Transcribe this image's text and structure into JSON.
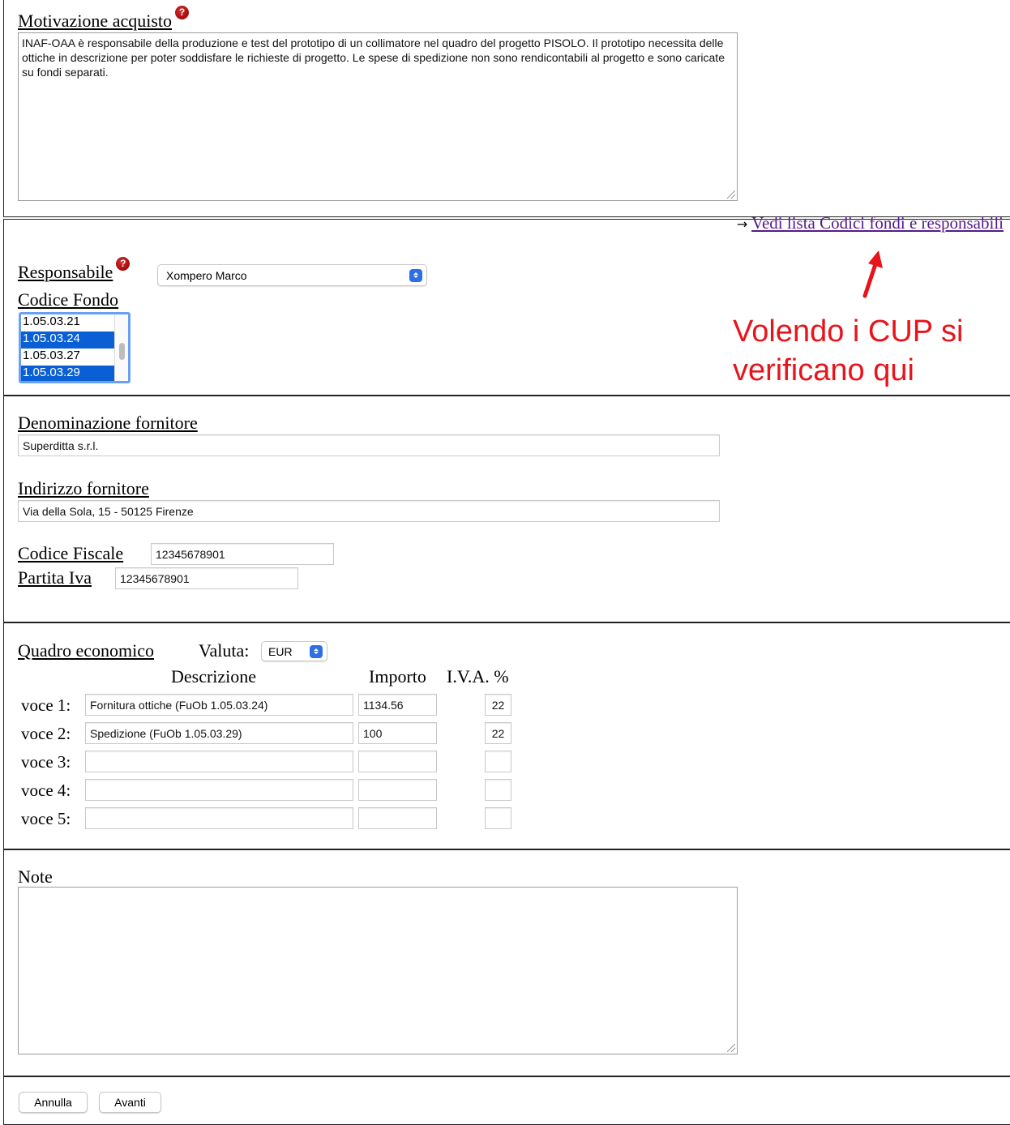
{
  "motivazione": {
    "label": "Motivazione acquisto",
    "help_icon": "?",
    "text": "INAF-OAA è responsabile della produzione e test del prototipo di un collimatore nel quadro del progetto PISOLO. Il prototipo necessita delle ottiche in descrizione per poter soddisfare le richieste di progetto. Le spese di spedizione non sono rendicontabili al progetto e sono caricate su fondi separati."
  },
  "fondi": {
    "arrow": "→",
    "link_label": "Vedi lista Codici fondi e responsabili",
    "responsabile_label": "Responsabile",
    "help_icon": "?",
    "responsabile_value": "Xompero Marco",
    "codice_fondo_label": "Codice Fondo",
    "codici": [
      {
        "code": "1.05.03.21",
        "selected": false
      },
      {
        "code": "1.05.03.24",
        "selected": true
      },
      {
        "code": "1.05.03.27",
        "selected": false
      },
      {
        "code": "1.05.03.29",
        "selected": true
      }
    ],
    "annotation_line1": "Volendo i CUP si",
    "annotation_line2": "verificano qui",
    "annotation_color": "#e8141b"
  },
  "fornitore": {
    "denominazione_label": "Denominazione fornitore",
    "denominazione_value": "Superditta s.r.l.",
    "indirizzo_label": "Indirizzo fornitore",
    "indirizzo_value": "Via della Sola, 15 - 50125 Firenze",
    "cf_label": "Codice Fiscale",
    "cf_value": "12345678901",
    "piva_label": "Partita Iva",
    "piva_value": "12345678901"
  },
  "quadro": {
    "label": "Quadro economico",
    "valuta_label": "Valuta:",
    "valuta_value": "EUR",
    "col_descrizione": "Descrizione",
    "col_importo": "Importo",
    "col_iva": "I.V.A. %",
    "voci": [
      {
        "label": "voce 1:",
        "descrizione": "Fornitura ottiche (FuOb 1.05.03.24)",
        "importo": "1134.56",
        "iva": "22"
      },
      {
        "label": "voce 2:",
        "descrizione": "Spedizione (FuOb 1.05.03.29)",
        "importo": "100",
        "iva": "22"
      },
      {
        "label": "voce 3:",
        "descrizione": "",
        "importo": "",
        "iva": ""
      },
      {
        "label": "voce 4:",
        "descrizione": "",
        "importo": "",
        "iva": ""
      },
      {
        "label": "voce 5:",
        "descrizione": "",
        "importo": "",
        "iva": ""
      }
    ]
  },
  "note": {
    "label": "Note",
    "text": ""
  },
  "buttons": {
    "annulla": "Annulla",
    "avanti": "Avanti"
  }
}
